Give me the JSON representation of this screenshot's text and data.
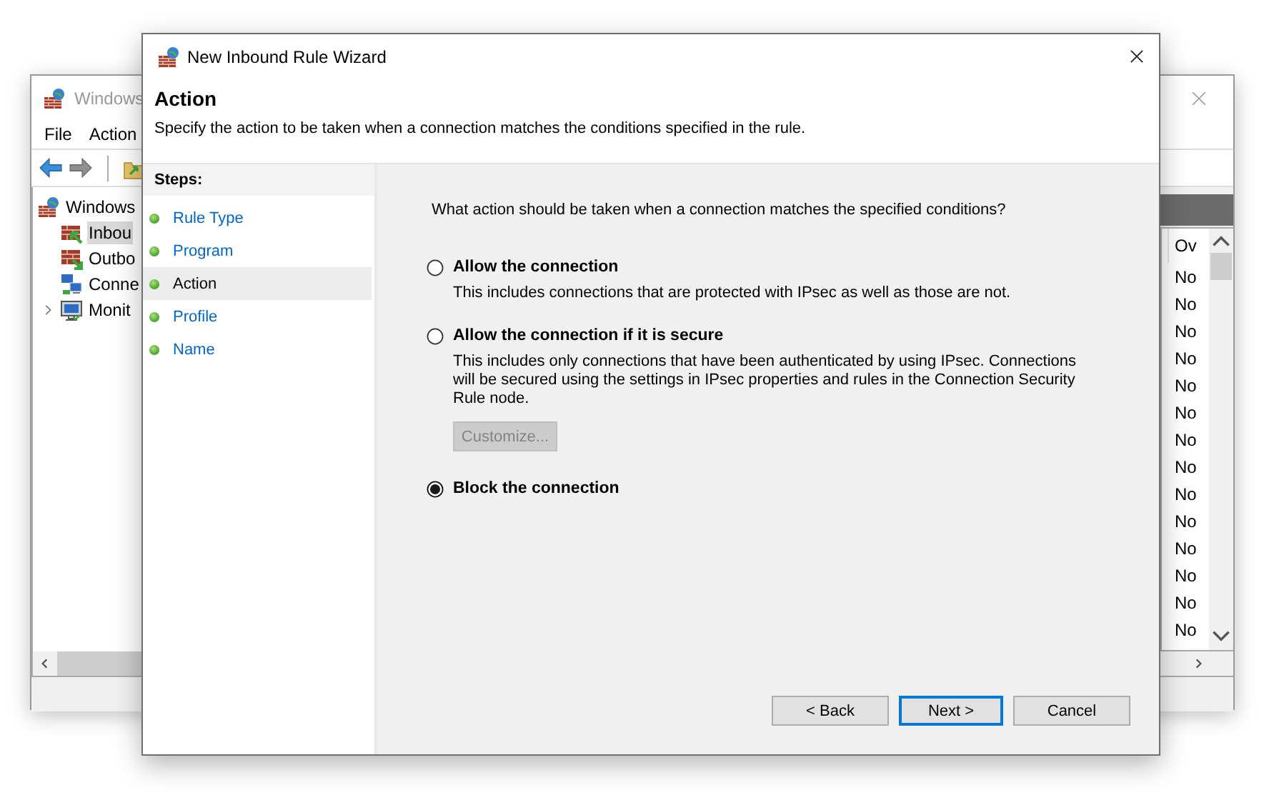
{
  "background_window": {
    "title": "Windows",
    "menu": [
      "File",
      "Action"
    ],
    "tree": [
      {
        "label": "Windows",
        "selected": false,
        "children": [
          {
            "label": "Inbou",
            "selected": true
          },
          {
            "label": "Outbo",
            "selected": false
          },
          {
            "label": "Conne",
            "selected": false
          },
          {
            "label": "Monit",
            "selected": false,
            "expanded": false
          }
        ]
      }
    ],
    "list": {
      "columns": [
        "Ov"
      ],
      "rows": [
        "No",
        "No",
        "No",
        "No",
        "No",
        "No",
        "No",
        "No",
        "No",
        "No",
        "No",
        "No",
        "No",
        "No"
      ]
    }
  },
  "wizard": {
    "title": "New Inbound Rule Wizard",
    "heading": "Action",
    "description": "Specify the action to be taken when a connection matches the conditions specified in the rule.",
    "steps_title": "Steps:",
    "steps": [
      {
        "label": "Rule Type",
        "selected": false
      },
      {
        "label": "Program",
        "selected": false
      },
      {
        "label": "Action",
        "selected": true
      },
      {
        "label": "Profile",
        "selected": false
      },
      {
        "label": "Name",
        "selected": false
      }
    ],
    "question": "What action should be taken when a connection matches the specified conditions?",
    "options": [
      {
        "label": "Allow the connection",
        "description": "This includes connections that are protected with IPsec as well as those are not.",
        "selected": false
      },
      {
        "label": "Allow the connection if it is secure",
        "description": "This includes only connections that have been authenticated by using IPsec.  Connections will be secured using the settings in IPsec properties and rules in the Connection Security Rule node.",
        "selected": false,
        "button": {
          "label": "Customize...",
          "disabled": true
        }
      },
      {
        "label": "Block the connection",
        "selected": true
      }
    ],
    "buttons": [
      {
        "label": "< Back",
        "default": false
      },
      {
        "label": "Next >",
        "default": true
      },
      {
        "label": "Cancel",
        "default": false
      }
    ]
  }
}
